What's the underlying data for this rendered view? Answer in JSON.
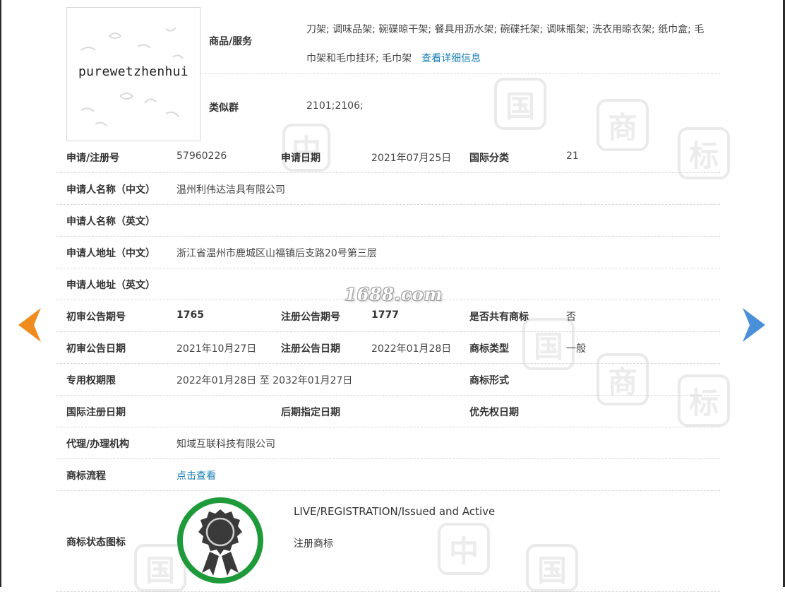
{
  "thumbnail": {
    "text": "purewetzhenhui"
  },
  "goods": {
    "label": "商品/服务",
    "text": "刀架; 调味品架; 碗碟晾干架; 餐具用沥水架; 碗碟托架; 调味瓶架; 洗衣用晾衣架; 纸巾盒; 毛巾架和毛巾挂环; 毛巾架",
    "detail_link": "查看详细信息"
  },
  "similar_group": {
    "label": "类似群",
    "value": "2101;2106;"
  },
  "rows": {
    "reg_no_label": "申请/注册号",
    "reg_no": "57960226",
    "app_date_label": "申请日期",
    "app_date": "2021年07月25日",
    "intl_class_label": "国际分类",
    "intl_class": "21",
    "applicant_cn_label": "申请人名称（中文）",
    "applicant_cn": "温州利伟达洁具有限公司",
    "applicant_en_label": "申请人名称（英文）",
    "applicant_en": "",
    "address_cn_label": "申请人地址（中文）",
    "address_cn": "浙江省温州市鹿城区山福镇后支路20号第三层",
    "address_en_label": "申请人地址（英文）",
    "address_en": "",
    "prelim_no_label": "初审公告期号",
    "prelim_no": "1765",
    "reg_pub_no_label": "注册公告期号",
    "reg_pub_no": "1777",
    "shared_label": "是否共有商标",
    "shared": "否",
    "prelim_date_label": "初审公告日期",
    "prelim_date": "2021年10月27日",
    "reg_pub_date_label": "注册公告日期",
    "reg_pub_date": "2022年01月28日",
    "mark_type_label": "商标类型",
    "mark_type": "一般",
    "exclusive_label": "专用权期限",
    "exclusive": "2022年01月28日 至 2032年01月27日",
    "mark_form_label": "商标形式",
    "mark_form": "",
    "intl_reg_date_label": "国际注册日期",
    "intl_reg_date": "",
    "later_date_label": "后期指定日期",
    "later_date": "",
    "priority_date_label": "优先权日期",
    "priority_date": "",
    "agent_label": "代理/办理机构",
    "agent": "知域互联科技有限公司",
    "flow_label": "商标流程",
    "flow_link": "点击查看",
    "status_icon_label": "商标状态图标",
    "status_en": "LIVE/REGISTRATION/Issued and Active",
    "status_cn": "注册商标"
  },
  "watermark": "1688.com",
  "colors": {
    "link": "#1a7fb5",
    "arrow_left": "#f08c1e",
    "arrow_right": "#4a90d9",
    "badge_ring": "#1e9a3a",
    "badge_seal": "#3a3a3a"
  },
  "icons": {
    "prev": "chevron-left-arrow-icon",
    "next": "chevron-right-arrow-icon",
    "status": "registered-seal-badge-icon"
  }
}
